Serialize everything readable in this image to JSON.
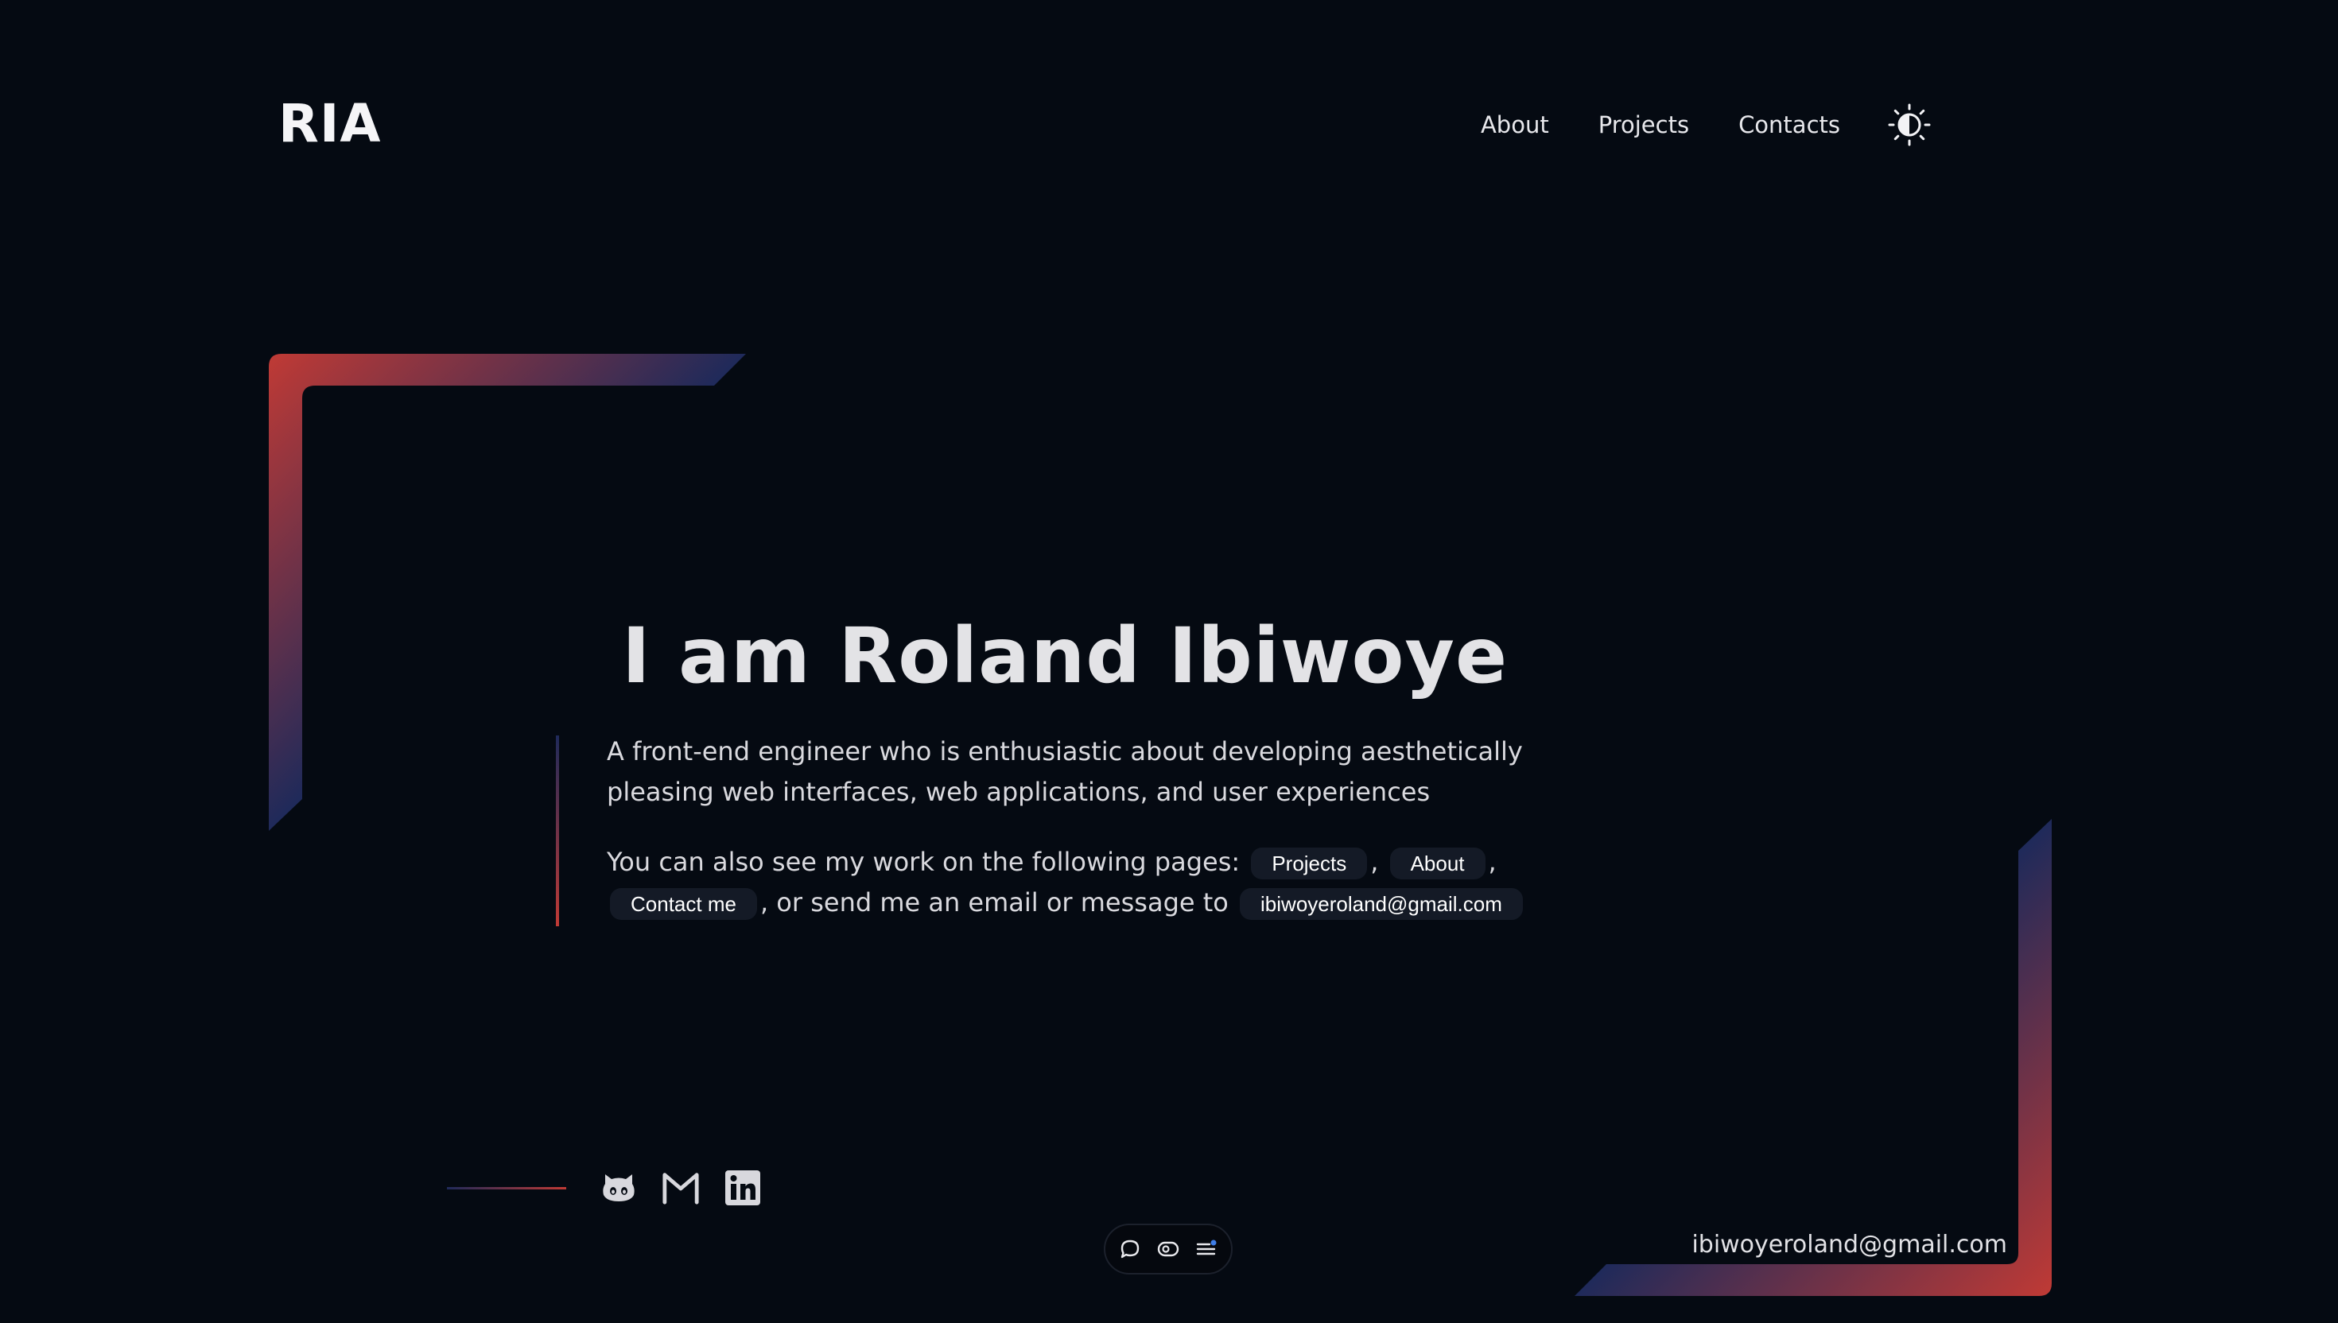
{
  "header": {
    "logo": "RIA",
    "nav": [
      {
        "label": "About"
      },
      {
        "label": "Projects"
      },
      {
        "label": "Contacts"
      }
    ],
    "theme_toggle_icon": "contrast-sun-icon"
  },
  "hero": {
    "title": "I am Roland Ibiwoye",
    "description": "A front-end engineer who is enthusiastic about developing aesthetically pleasing web interfaces, web applications, and user experiences",
    "links_intro": "You can also see my work on the following pages:",
    "chip_projects": "Projects",
    "comma_1": ",",
    "chip_about": "About",
    "comma_2": ",",
    "chip_contact": "Contact me",
    "links_outro": ", or send me an email or message to",
    "chip_email": "ibiwoyeroland@gmail.com"
  },
  "social": {
    "icons": [
      "github-icon",
      "gmail-icon",
      "linkedin-icon"
    ]
  },
  "dock": {
    "icons": [
      "chat-bubble-icon",
      "toggle-pill-icon",
      "menu-icon"
    ]
  },
  "footer": {
    "email": "ibiwoyeroland@gmail.com"
  },
  "colors": {
    "background": "#050a12",
    "accent_red": "#c03a35",
    "accent_navy": "#1f2a5a",
    "chip_background": "#141a26",
    "text": "#e3e3e6"
  }
}
